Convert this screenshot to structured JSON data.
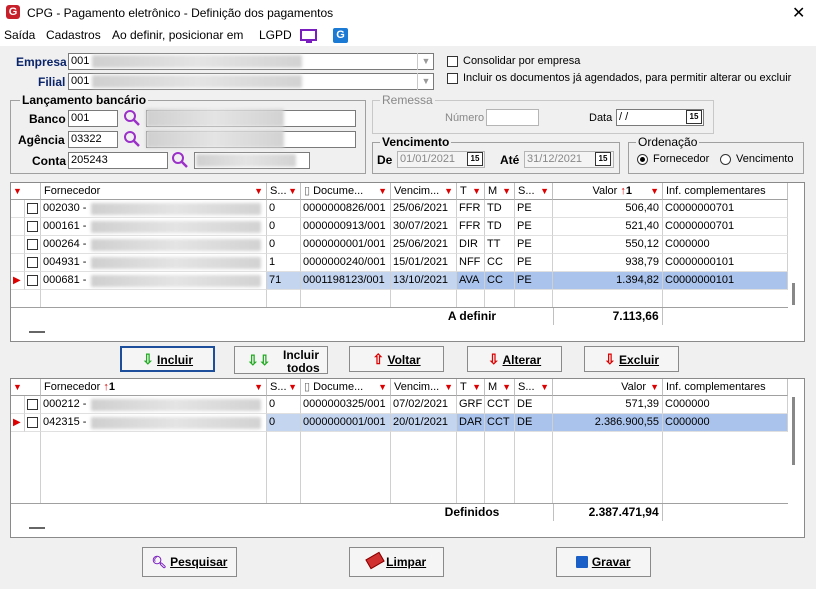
{
  "window": {
    "title": "CPG - Pagamento eletrônico - Definição dos pagamentos"
  },
  "menu": [
    "Saída",
    "Cadastros",
    "Ao definir, posicionar em",
    "LGPD"
  ],
  "form": {
    "empresa_label": "Empresa",
    "empresa_value": "001",
    "filial_label": "Filial",
    "filial_value": "001",
    "consolidar_label": "Consolidar por empresa",
    "incluir_docs_label": "Incluir os documentos já agendados, para permitir alterar ou excluir"
  },
  "lancamento": {
    "title": "Lançamento bancário",
    "banco_label": "Banco",
    "banco_value": "001",
    "agencia_label": "Agência",
    "agencia_value": "03322",
    "conta_label": "Conta",
    "conta_value": "205243"
  },
  "remessa": {
    "title": "Remessa",
    "numero_label": "Número",
    "data_label": "Data",
    "data_value": " /  /"
  },
  "vencimento": {
    "title": "Vencimento",
    "de_label": "De",
    "de_value": "01/01/2021",
    "ate_label": "Até",
    "ate_value": "31/12/2021"
  },
  "ordenacao": {
    "title": "Ordenação",
    "opt1": "Fornecedor",
    "opt2": "Vencimento",
    "selected": "Fornecedor"
  },
  "grid_headers": {
    "fornecedor": "Fornecedor",
    "s": "S...",
    "documento": "Docume...",
    "vencimento": "Vencim...",
    "t": "T",
    "m": "M",
    "s2": "S...",
    "valor": "Valor",
    "inf": "Inf. complementares"
  },
  "top_grid": {
    "rows": [
      {
        "code": "002030 -",
        "s": "0",
        "doc": "0000000826/001",
        "venc": "25/06/2021",
        "t": "FFR",
        "m": "TD",
        "s2": "PE",
        "valor": "506,40",
        "inf": "C0000000701"
      },
      {
        "code": "000161 -",
        "s": "0",
        "doc": "0000000913/001",
        "venc": "30/07/2021",
        "t": "FFR",
        "m": "TD",
        "s2": "PE",
        "valor": "521,40",
        "inf": "C0000000701"
      },
      {
        "code": "000264 -",
        "s": "0",
        "doc": "0000000001/001",
        "venc": "25/06/2021",
        "t": "DIR",
        "m": "TT",
        "s2": "PE",
        "valor": "550,12",
        "inf": "C000000"
      },
      {
        "code": "004931 -",
        "s": "1",
        "doc": "0000000240/001",
        "venc": "15/01/2021",
        "t": "NFF",
        "m": "CC",
        "s2": "PE",
        "valor": "938,79",
        "inf": "C0000000101"
      },
      {
        "code": "000681 -",
        "s": "71",
        "doc": "0001198123/001",
        "venc": "13/10/2021",
        "t": "AVA",
        "m": "CC",
        "s2": "PE",
        "valor": "1.394,82",
        "inf": "C0000000101"
      }
    ],
    "footer_label": "A definir",
    "footer_total": "7.113,66"
  },
  "buttons": {
    "incluir": "Incluir",
    "incluir_todos_1": "Incluir",
    "incluir_todos_2": "todos",
    "voltar": "Voltar",
    "alterar": "Alterar",
    "excluir": "Excluir",
    "pesquisar": "Pesquisar",
    "limpar": "Limpar",
    "gravar": "Gravar"
  },
  "bottom_grid": {
    "sort_indicator": "1",
    "rows": [
      {
        "code": "000212 -",
        "s": "0",
        "doc": "0000000325/001",
        "venc": "07/02/2021",
        "t": "GRF",
        "m": "CCT",
        "s2": "DE",
        "valor": "571,39",
        "inf": "C000000"
      },
      {
        "code": "042315 -",
        "s": "0",
        "doc": "0000000001/001",
        "venc": "20/01/2021",
        "t": "DAR",
        "m": "CCT",
        "s2": "DE",
        "valor": "2.386.900,55",
        "inf": "C000000"
      }
    ],
    "footer_label": "Definidos",
    "footer_total": "2.387.471,94"
  },
  "top_sort_indicator": "1",
  "colors": {
    "accent": "#1c4e9c",
    "selected_row": "#c4d5f0",
    "filter_red": "#dd0000",
    "app_red": "#c8202b"
  }
}
